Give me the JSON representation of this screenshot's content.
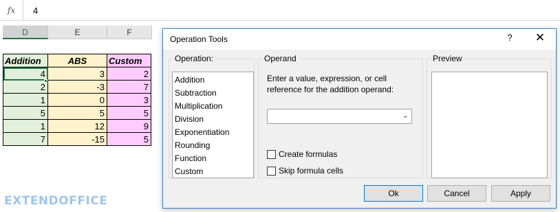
{
  "formula_bar": {
    "fx_label": "fx",
    "value": "4"
  },
  "columns": [
    {
      "letter": "D",
      "selected": true
    },
    {
      "letter": "E",
      "selected": false
    },
    {
      "letter": "F",
      "selected": false
    }
  ],
  "table": {
    "headers": [
      "Addition",
      "ABS",
      "Custom"
    ],
    "rows": [
      [
        "4",
        "3",
        "2"
      ],
      [
        "2",
        "-3",
        "7"
      ],
      [
        "1",
        "0",
        "3"
      ],
      [
        "5",
        "5",
        "5"
      ],
      [
        "1",
        "12",
        "9"
      ],
      [
        "7",
        "-15",
        "5"
      ]
    ]
  },
  "watermark": "EXTENDOFFICE",
  "dialog": {
    "title": "Operation Tools",
    "help_label": "?",
    "close_label": "✕",
    "operation": {
      "legend": "Operation:",
      "items": [
        "Addition",
        "Subtraction",
        "Multiplication",
        "Division",
        "Exponentiation",
        "Rounding",
        "Function",
        "Custom"
      ]
    },
    "operand": {
      "legend": "Operand",
      "prompt": "Enter a value, expression, or cell reference for the addition operand:",
      "value": "",
      "create_formulas_label": "Create formulas",
      "skip_formula_cells_label": "Skip formula cells"
    },
    "preview": {
      "legend": "Preview"
    },
    "buttons": {
      "ok": "Ok",
      "cancel": "Cancel",
      "apply": "Apply"
    }
  },
  "colors": {
    "addition": "#e2efda",
    "abs": "#fff2cc",
    "custom": "#ffccff",
    "accent": "#217346"
  }
}
